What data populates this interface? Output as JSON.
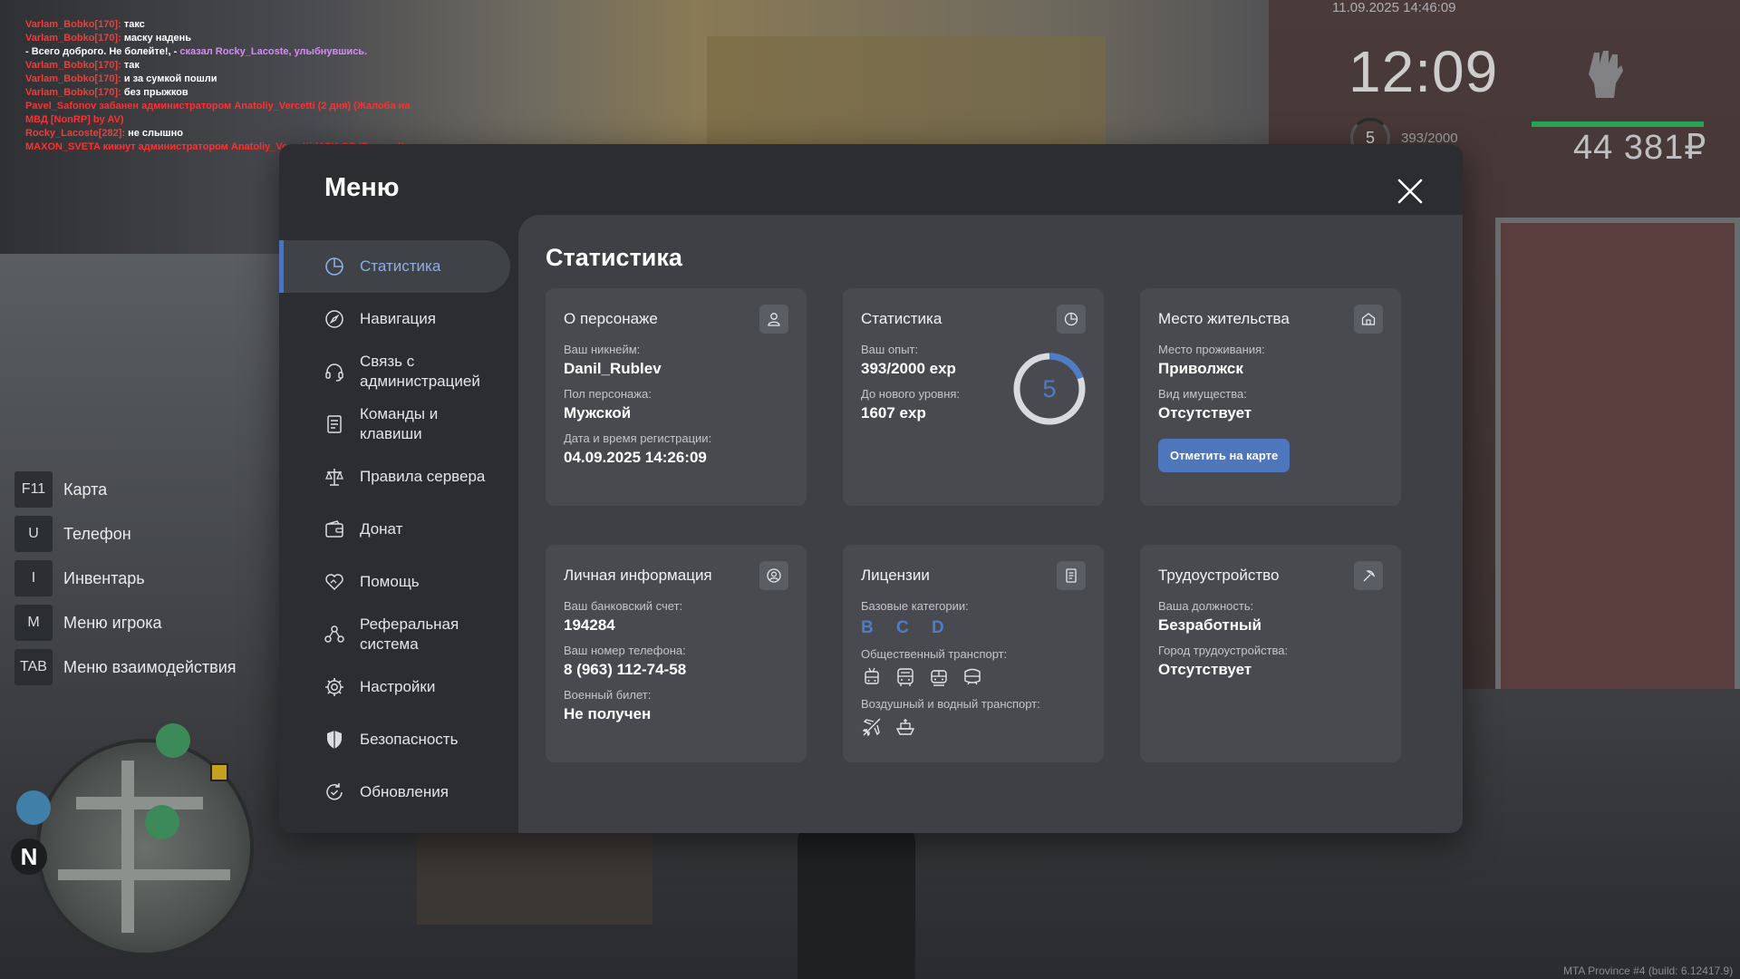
{
  "chat": [
    {
      "nick": "Varlam_Bobko[170]:",
      "text": " такс",
      "type": "say"
    },
    {
      "nick": "Varlam_Bobko[170]:",
      "text": " маску надень",
      "type": "say"
    },
    {
      "nick": "",
      "text": "- Всего доброго. Не болейте!, - ",
      "action": "сказал Rocky_Lacoste, улыбнувшись.",
      "type": "act"
    },
    {
      "nick": "Varlam_Bobko[170]:",
      "text": " так",
      "type": "say"
    },
    {
      "nick": "Varlam_Bobko[170]:",
      "text": " и за сумкой пошли",
      "type": "say"
    },
    {
      "nick": "Varlam_Bobko[170]:",
      "text": " без прыжков",
      "type": "say"
    },
    {
      "nick": "",
      "text": "Pavel_Safonov забанен администратором Anatoliy_Vercetti (2 дня) (Жалоба на",
      "type": "sys"
    },
    {
      "nick": "",
      "text": " МВД [NonRP] by AV)",
      "type": "sys"
    },
    {
      "nick": "Rocky_Lacoste[282]:",
      "text": " не слышно",
      "type": "say"
    },
    {
      "nick": "",
      "text": "MAXON_SVETA кикнут администратором Anatoliy_Vercetti (AFK ОТ (Помеха))",
      "type": "sys"
    }
  ],
  "hud": {
    "date": "11.09.2025 14:46:09",
    "time": "12:09",
    "level": "5",
    "exp": "393/2000",
    "money": "44 381₽",
    "health_fraction": 1.0
  },
  "hotkeys": [
    {
      "key": "F11",
      "label": "Карта"
    },
    {
      "key": "U",
      "label": "Телефон"
    },
    {
      "key": "I",
      "label": "Инвентарь"
    },
    {
      "key": "M",
      "label": "Меню игрока"
    },
    {
      "key": "TAB",
      "label": "Меню взаимодействия"
    }
  ],
  "minimap": {
    "north": "N"
  },
  "build": "MTA Province #4 (build: 6.12417.9)",
  "menu": {
    "title": "Меню",
    "nav": [
      {
        "label": "Статистика",
        "icon": "pie-chart-icon",
        "active": true
      },
      {
        "label": "Навигация",
        "icon": "compass-icon",
        "active": false
      },
      {
        "label": "Связь с администрацией",
        "icon": "headset-icon",
        "active": false
      },
      {
        "label": "Команды и клавиши",
        "icon": "document-list-icon",
        "active": false
      },
      {
        "label": "Правила сервера",
        "icon": "scales-icon",
        "active": false
      },
      {
        "label": "Донат",
        "icon": "wallet-icon",
        "active": false
      },
      {
        "label": "Помощь",
        "icon": "helping-hand-icon",
        "active": false
      },
      {
        "label": "Реферальная система",
        "icon": "referral-icon",
        "active": false
      },
      {
        "label": "Настройки",
        "icon": "gear-icon",
        "active": false
      },
      {
        "label": "Безопасность",
        "icon": "shield-icon",
        "active": false
      },
      {
        "label": "Обновления",
        "icon": "refresh-icon",
        "active": false
      }
    ],
    "content_title": "Статистика",
    "cards": {
      "character": {
        "title": "О персонаже",
        "nickname_label": "Ваш никнейм:",
        "nickname": "Danil_Rublev",
        "gender_label": "Пол персонажа:",
        "gender": "Мужской",
        "reg_label": "Дата и время регистрации:",
        "reg": "04.09.2025 14:26:09"
      },
      "stats": {
        "title": "Статистика",
        "exp_label": "Ваш опыт:",
        "exp": "393/2000 exp",
        "next_label": "До нового уровня:",
        "next": "1607 exp",
        "level": "5",
        "progress_fraction": 0.1965
      },
      "residence": {
        "title": "Место жительства",
        "place_label": "Место проживания:",
        "place": "Приволжск",
        "property_label": "Вид имущества:",
        "property": "Отсутствует",
        "button": "Отметить на карте"
      },
      "personal": {
        "title": "Личная информация",
        "bank_label": "Ваш банковский счет:",
        "bank": "194284",
        "phone_label": "Ваш номер телефона:",
        "phone": "8 (963) 112-74-58",
        "military_label": "Военный билет:",
        "military": "Не получен"
      },
      "licenses": {
        "title": "Лицензии",
        "base_label": "Базовые категории:",
        "base": "B C D",
        "public_label": "Общественный транспорт:",
        "public_icons": [
          "trolleybus-icon",
          "bus-icon",
          "tram-icon",
          "metro-icon"
        ],
        "air_label": "Воздушный и водный транспорт:",
        "air_icons": [
          "airplane-icon",
          "boat-icon"
        ]
      },
      "employment": {
        "title": "Трудоустройство",
        "position_label": "Ваша должность:",
        "position": "Безработный",
        "city_label": "Город трудоустройства:",
        "city": "Отсутствует"
      }
    }
  },
  "colors": {
    "accent": "#4d76bc",
    "panel": "#2b2d31",
    "content": "#3e4045",
    "card": "#484a50",
    "health": "#2aa254"
  }
}
